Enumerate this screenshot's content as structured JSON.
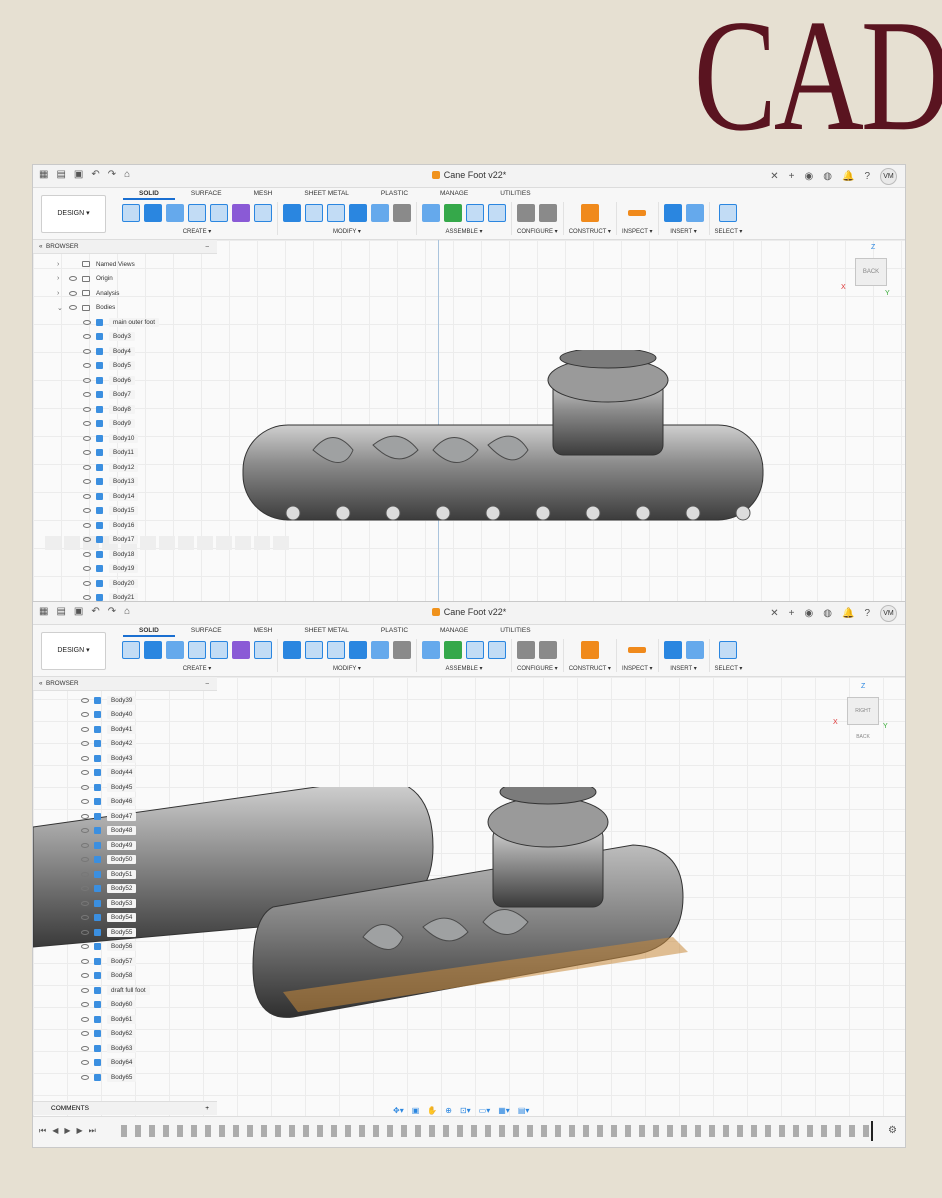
{
  "brand": "CAD",
  "app": {
    "title": "Cane Foot v22*",
    "avatar": "VM",
    "workspace": "DESIGN",
    "tabs": [
      "SOLID",
      "SURFACE",
      "MESH",
      "SHEET METAL",
      "PLASTIC",
      "MANAGE",
      "UTILITIES"
    ],
    "groups": [
      "CREATE",
      "MODIFY",
      "ASSEMBLE",
      "CONFIGURE",
      "CONSTRUCT",
      "INSPECT",
      "INSERT",
      "SELECT"
    ],
    "browser_title": "BROWSER",
    "comments_label": "COMMENTS"
  },
  "viewcube1": {
    "face": "BACK",
    "axes": [
      "Z",
      "X",
      "Y"
    ]
  },
  "viewcube2": {
    "faces": [
      "RIGHT",
      "BACK"
    ],
    "axes": [
      "Z",
      "X",
      "Y"
    ]
  },
  "browser1": {
    "folders": [
      "Named Views",
      "Origin",
      "Analysis",
      "Bodies"
    ],
    "bodies": [
      "main outer foot",
      "Body3",
      "Body4",
      "Body5",
      "Body6",
      "Body7",
      "Body8",
      "Body9",
      "Body10",
      "Body11",
      "Body12",
      "Body13",
      "Body14",
      "Body15",
      "Body16",
      "Body17",
      "Body18",
      "Body19",
      "Body20",
      "Body21"
    ]
  },
  "browser2": {
    "bodies": [
      "Body39",
      "Body40",
      "Body41",
      "Body42",
      "Body43",
      "Body44",
      "Body45",
      "Body46",
      "Body47",
      "Body48",
      "Body49",
      "Body50",
      "Body51",
      "Body52",
      "Body53",
      "Body54",
      "Body55",
      "Body56",
      "Body57",
      "Body58",
      "draft full foot",
      "Body60",
      "Body61",
      "Body62",
      "Body63",
      "Body64",
      "Body65"
    ]
  },
  "colors": {
    "brand": "#5a1420",
    "accent": "#2a86e0",
    "highlight": "#c98a3c"
  }
}
